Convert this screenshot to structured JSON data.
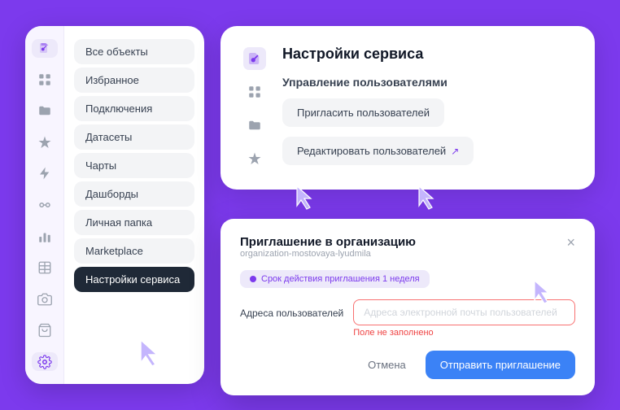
{
  "sidebar": {
    "nav_items": [
      {
        "label": "Все объекты",
        "active": false
      },
      {
        "label": "Избранное",
        "active": false
      },
      {
        "label": "Подключения",
        "active": false
      },
      {
        "label": "Датасеты",
        "active": false
      },
      {
        "label": "Чарты",
        "active": false
      },
      {
        "label": "Дашборды",
        "active": false
      },
      {
        "label": "Личная папка",
        "active": false
      },
      {
        "label": "Marketplace",
        "active": false
      },
      {
        "label": "Настройки сервиса",
        "active": true
      }
    ],
    "icons": [
      {
        "name": "logo-icon"
      },
      {
        "name": "grid-icon"
      },
      {
        "name": "folder-icon"
      },
      {
        "name": "star-icon"
      },
      {
        "name": "lightning-icon"
      },
      {
        "name": "link-icon"
      },
      {
        "name": "chart-icon"
      },
      {
        "name": "table-icon"
      },
      {
        "name": "camera-icon"
      },
      {
        "name": "cart-icon"
      },
      {
        "name": "settings-icon"
      }
    ]
  },
  "service_card": {
    "title": "Настройки сервиса",
    "user_management_label": "Управление пользователями",
    "invite_btn": "Пригласить пользователей",
    "edit_btn": "Редактировать пользователей"
  },
  "invite_dialog": {
    "title": "Приглашение в организацию",
    "org_name": "organization-mostovaya-lyudmila",
    "expiry_text": "Срок действия приглашения 1 неделя",
    "email_label": "Адреса пользователей",
    "email_placeholder": "Адреса электронной почты пользователей",
    "error_text": "Поле не заполнено",
    "cancel_btn": "Отмена",
    "send_btn": "Отправить приглашение",
    "close_label": "×"
  }
}
